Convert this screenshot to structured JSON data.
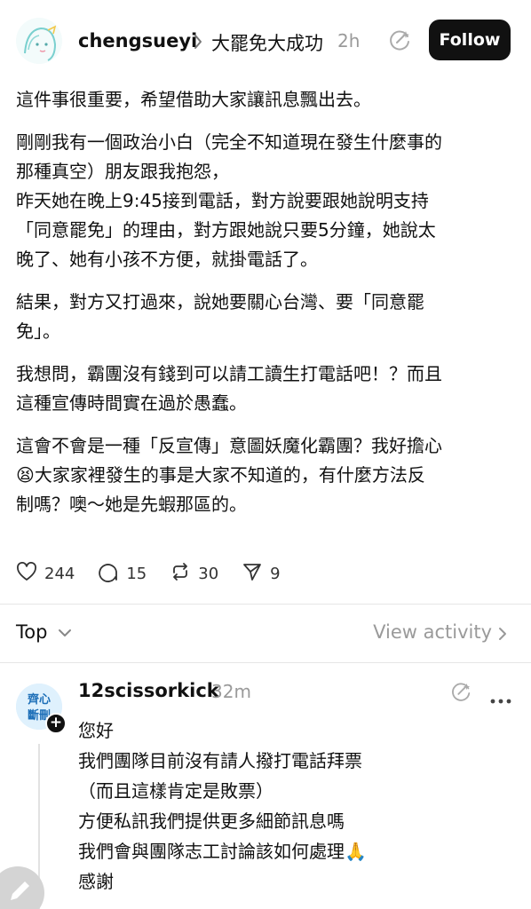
{
  "post": {
    "username": "chengsueyi",
    "topic": "大罷免大成功",
    "time": "2h",
    "follow_label": "Follow",
    "paragraphs": [
      "這件事很重要，希望借助大家讓訊息飄出去。",
      "剛剛我有一個政治小白（完全不知道現在發生什麼事的\n那種真空）朋友跟我抱怨，\n昨天她在晚上9:45接到電話，對方說要跟她說明支持\n「同意罷免」的理由，對方跟她說只要5分鐘，她說太\n晚了、她有小孩不方便，就掛電話了。",
      "結果，對方又打過來，說她要關心台灣、要「同意罷\n免」。",
      "我想問，霸團沒有錢到可以請工讀生打電話吧！？而且\n這種宣傳時間實在過於愚蠢。",
      "這會不會是一種「反宣傳」意圖妖魔化霸團？我好擔心\n😫大家家裡發生的事是大家不知道的，有什麼方法反\n制嗎？噢～她是先蝦那區的。"
    ],
    "likes": "244",
    "replies": "15",
    "reposts": "30",
    "shares": "9"
  },
  "sort": {
    "label": "Top",
    "view_activity": "View activity"
  },
  "reply": {
    "username": "12scissorkick",
    "time": "32m",
    "avatar_text": "齊心",
    "avatar_text2": "斷刪",
    "lines": [
      "您好",
      "我們團隊目前沒有請人撥打電話拜票",
      "（而且這樣肯定是敗票）",
      "方便私訊我們提供更多細節訊息嗎",
      "我們會與團隊志工討論該如何處理🙏",
      "感謝"
    ]
  },
  "colors": {
    "text": "#101010",
    "muted": "#9a9a9a",
    "button_bg": "#111111",
    "divider": "#e6e6e6"
  },
  "icons": [
    "chevron-right-icon",
    "ai-sparkle-icon",
    "heart-icon",
    "comment-icon",
    "repost-icon",
    "share-icon",
    "chevron-down-icon",
    "more-icon",
    "compose-icon"
  ]
}
